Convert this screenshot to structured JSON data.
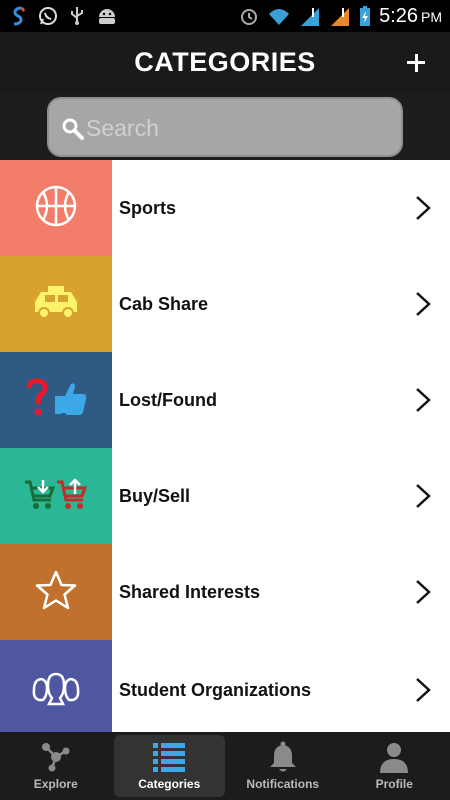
{
  "status_bar": {
    "time": "5:26",
    "ampm": "PM",
    "left_icons": [
      "app-icon",
      "whatsapp-icon",
      "usb-icon",
      "android-icon"
    ],
    "right_icons": [
      "alarm-icon",
      "wifi-icon",
      "signal-icon",
      "signal-icon",
      "battery-charging-icon"
    ]
  },
  "header": {
    "title": "CATEGORIES",
    "add_icon": "plus-icon"
  },
  "search": {
    "placeholder": "Search"
  },
  "categories": [
    {
      "label": "Sports",
      "color": "#f27d6a",
      "icon": "basketball-icon"
    },
    {
      "label": "Cab Share",
      "color": "#d9a22e",
      "icon": "taxi-icon"
    },
    {
      "label": "Lost/Found",
      "color": "#2e5a84",
      "icon": "question-thumbs-up-icon"
    },
    {
      "label": "Buy/Sell",
      "color": "#29b795",
      "icon": "shopping-carts-icon"
    },
    {
      "label": "Shared Interests",
      "color": "#c1702e",
      "icon": "star-icon"
    },
    {
      "label": "Student Organizations",
      "color": "#4f56a2",
      "icon": "people-group-icon"
    }
  ],
  "bottom_nav": {
    "items": [
      {
        "label": "Explore",
        "icon": "network-icon",
        "active": false
      },
      {
        "label": "Categories",
        "icon": "list-icon",
        "active": true
      },
      {
        "label": "Notifications",
        "icon": "bell-icon",
        "active": false
      },
      {
        "label": "Profile",
        "icon": "person-icon",
        "active": false
      }
    ]
  },
  "colors": {
    "header_bg": "#1a1a1a",
    "nav_bg": "#1c1c1c",
    "search_bg": "#a6a6a6"
  }
}
